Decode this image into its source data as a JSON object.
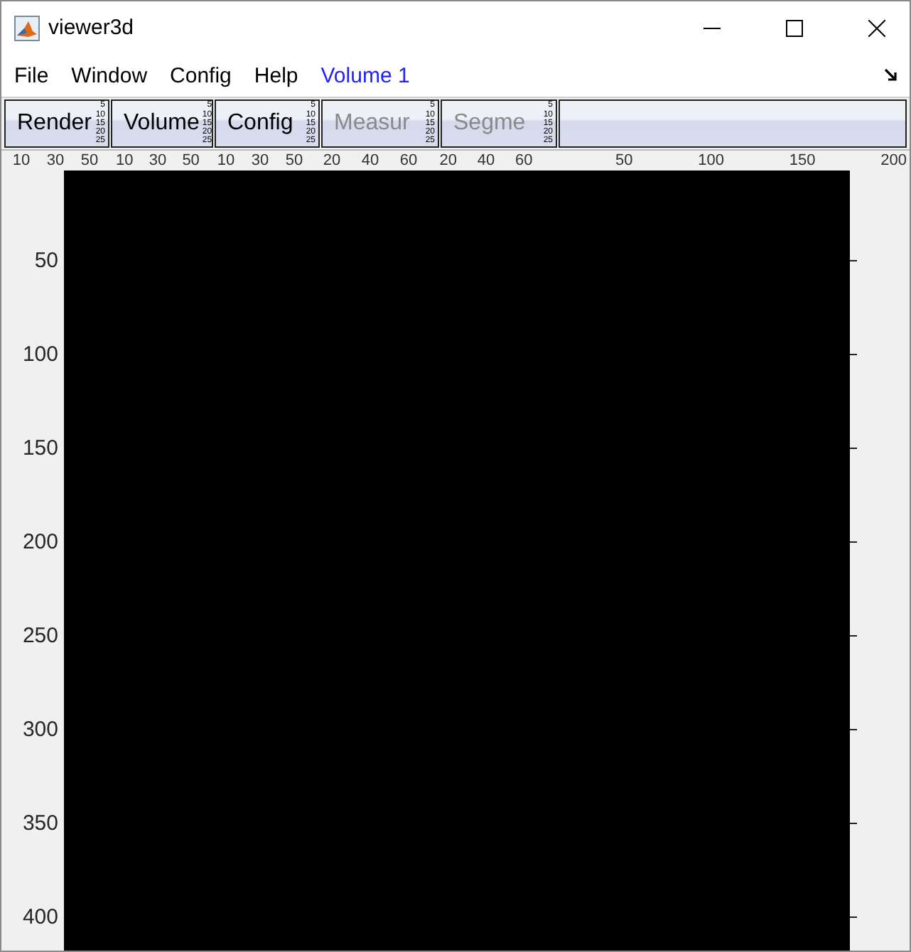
{
  "window": {
    "title": "viewer3d"
  },
  "menu": [
    {
      "label": "File",
      "kind": "menu"
    },
    {
      "label": "Window",
      "kind": "menu"
    },
    {
      "label": "Config",
      "kind": "menu"
    },
    {
      "label": "Help",
      "kind": "menu"
    },
    {
      "label": "Volume 1",
      "kind": "volume"
    }
  ],
  "panels": [
    {
      "label": "Render",
      "disabled": false,
      "yticks": [
        "5",
        "10",
        "15",
        "20",
        "25"
      ],
      "xticks": [
        "10",
        "30",
        "50"
      ]
    },
    {
      "label": "Volume",
      "disabled": false,
      "yticks": [
        "5",
        "10",
        "15",
        "20",
        "25"
      ],
      "xticks": [
        "10",
        "30",
        "50"
      ]
    },
    {
      "label": "Config",
      "disabled": false,
      "yticks": [
        "5",
        "10",
        "15",
        "20",
        "25"
      ],
      "xticks": [
        "10",
        "30",
        "50"
      ]
    },
    {
      "label": "Measur",
      "disabled": true,
      "yticks": [
        "5",
        "10",
        "15",
        "20",
        "25"
      ],
      "xticks": [
        "20",
        "40",
        "60"
      ]
    },
    {
      "label": "Segme",
      "disabled": true,
      "yticks": [
        "5",
        "10",
        "15",
        "20",
        "25"
      ],
      "xticks": [
        "20",
        "40",
        "60"
      ]
    }
  ],
  "image_axes": {
    "xticks": [
      "50",
      "100",
      "150",
      "200"
    ],
    "yticks": [
      "50",
      "100",
      "150",
      "200",
      "250",
      "300",
      "350",
      "400"
    ]
  }
}
